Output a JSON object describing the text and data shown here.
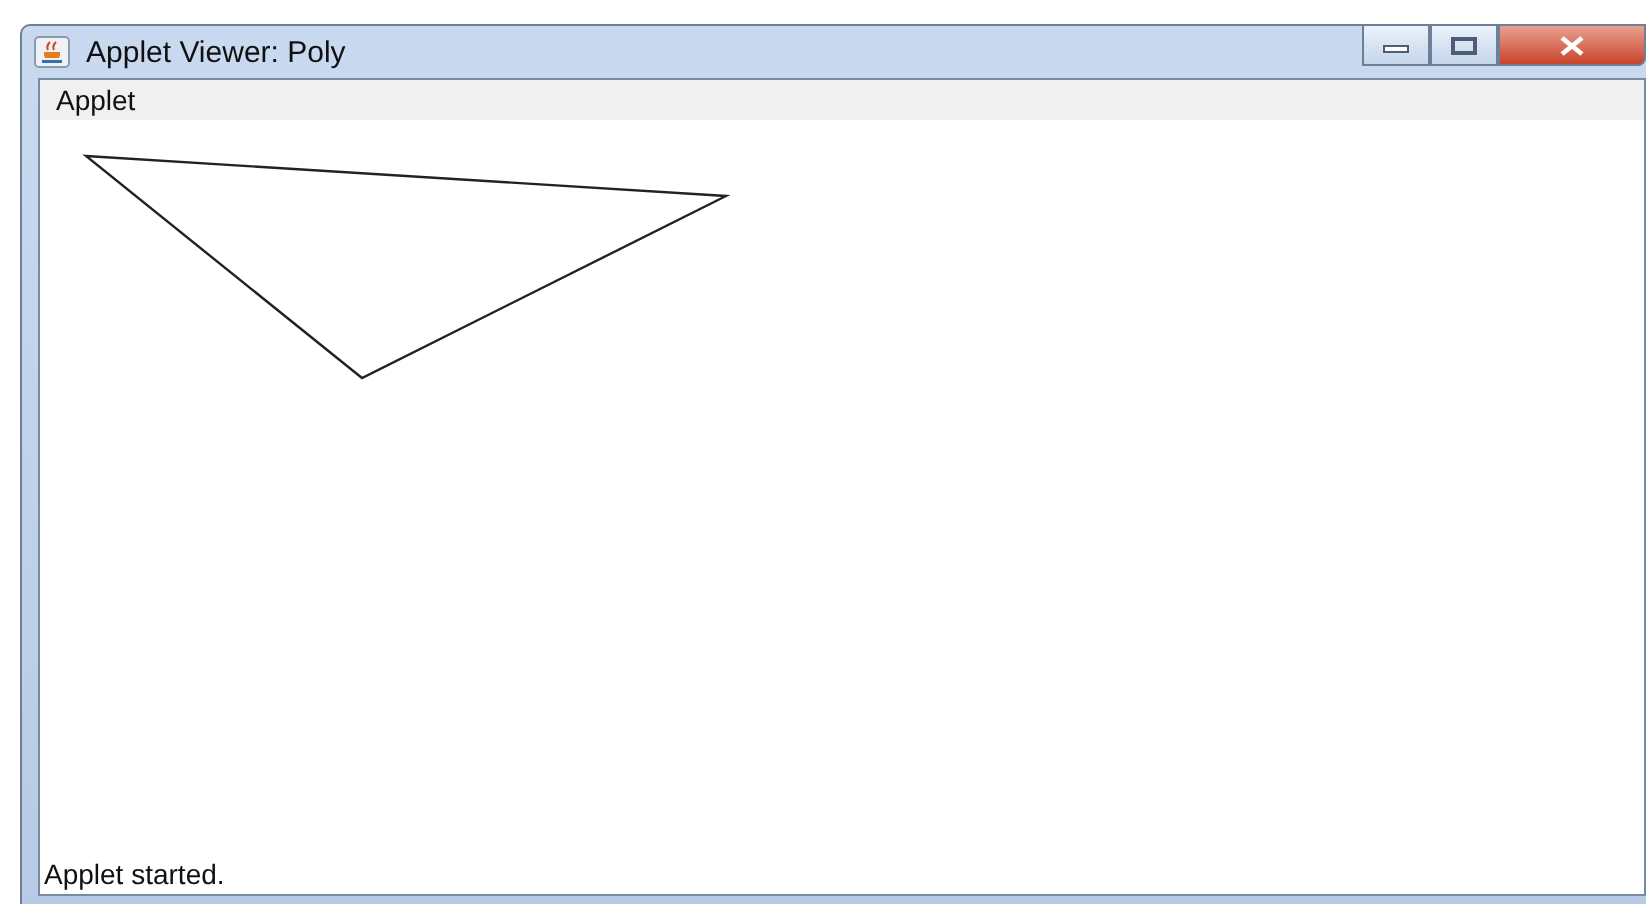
{
  "window": {
    "title": "Applet Viewer: Poly"
  },
  "menu": [
    "Applet"
  ],
  "status_bar": "Applet started."
}
